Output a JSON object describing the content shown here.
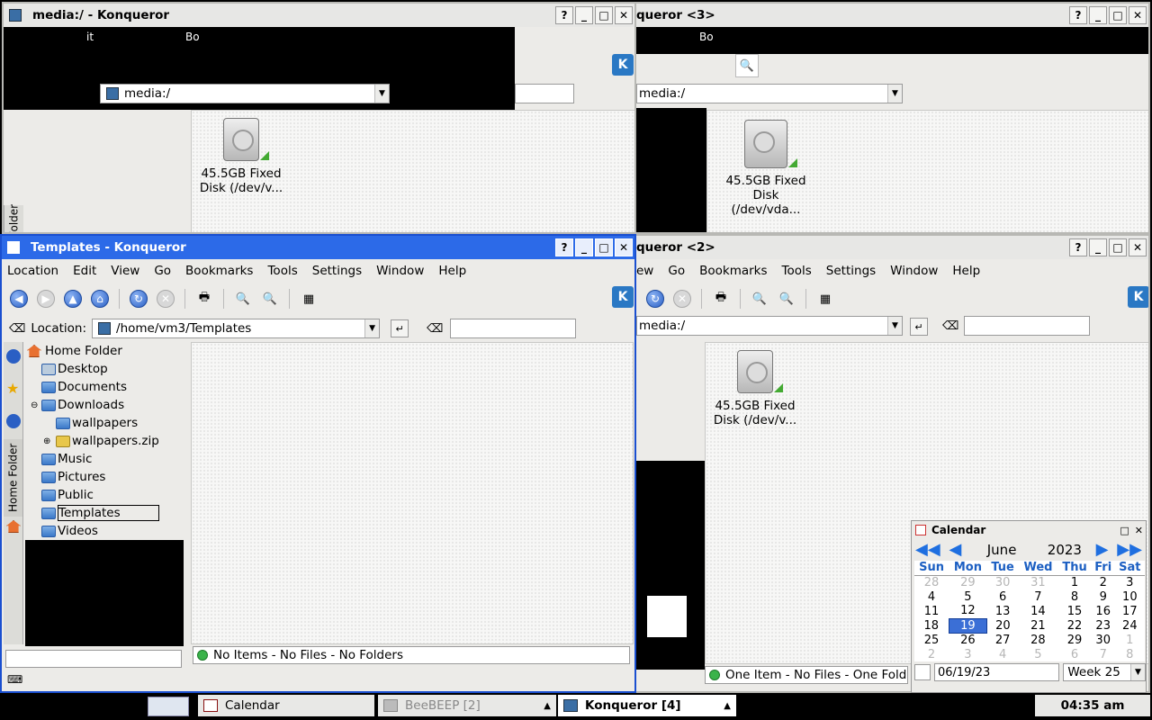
{
  "windows": {
    "w1": {
      "title": "media:/ - Konqueror",
      "location": "media:/",
      "disk_label": "45.5GB Fixed Disk (/dev/v...",
      "side_tab": "Folder",
      "partial_toolbar": [
        "it",
        "Bo"
      ]
    },
    "w3": {
      "title": "queror <3>",
      "location": "media:/",
      "disk_label": "45.5GB Fixed Disk (/dev/vda...",
      "partial_toolbar": "Bo"
    },
    "w2": {
      "title": "queror <2>",
      "location": "media:/",
      "disk_label": "45.5GB Fixed Disk (/dev/v...",
      "menus": [
        "ew",
        "Go",
        "Bookmarks",
        "Tools",
        "Settings",
        "Window",
        "Help"
      ],
      "status": "One Item - No Files - One Folde"
    },
    "main": {
      "title": "Templates - Konqueror",
      "menus": [
        "Location",
        "Edit",
        "View",
        "Go",
        "Bookmarks",
        "Tools",
        "Settings",
        "Window",
        "Help"
      ],
      "location_label": "Location:",
      "location": "/home/vm3/Templates",
      "side_tab": "Home Folder",
      "tree": {
        "root": "Home Folder",
        "items": [
          "Desktop",
          "Documents",
          "Downloads",
          "wallpapers",
          "wallpapers.zip",
          "Music",
          "Pictures",
          "Public",
          "Templates",
          "Videos"
        ],
        "selected": "Templates"
      },
      "status": "No Items - No Files - No Folders"
    }
  },
  "window_buttons": [
    "?",
    "_",
    "□",
    "✕"
  ],
  "calendar": {
    "title": "Calendar",
    "month": "June",
    "year": "2023",
    "weekdays": [
      "Sun",
      "Mon",
      "Tue",
      "Wed",
      "Thu",
      "Fri",
      "Sat"
    ],
    "weeks": [
      [
        "28",
        "29",
        "30",
        "31",
        "1",
        "2",
        "3"
      ],
      [
        "4",
        "5",
        "6",
        "7",
        "8",
        "9",
        "10"
      ],
      [
        "11",
        "12",
        "13",
        "14",
        "15",
        "16",
        "17"
      ],
      [
        "18",
        "19",
        "20",
        "21",
        "22",
        "23",
        "24"
      ],
      [
        "25",
        "26",
        "27",
        "28",
        "29",
        "30",
        "1"
      ],
      [
        "2",
        "3",
        "4",
        "5",
        "6",
        "7",
        "8"
      ]
    ],
    "selected_day": "19",
    "date_field": "06/19/23",
    "week_select": "Week 25"
  },
  "taskbar": {
    "tasks": [
      "Calendar",
      "BeeBEEP [2]",
      "Konqueror [4]"
    ],
    "clock": "04:35 am"
  }
}
